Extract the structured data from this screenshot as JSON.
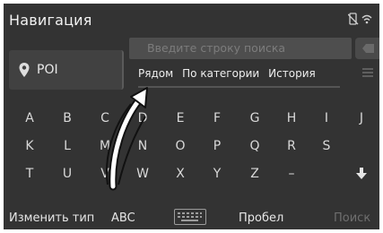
{
  "header": {
    "title": "Навигация",
    "status_icons": [
      "phone-off-icon",
      "wifi-icon"
    ]
  },
  "search": {
    "placeholder": "Введите строку поиска",
    "button_icon": "backspace-icon"
  },
  "poi": {
    "icon": "location-pin-icon",
    "label": "POI"
  },
  "tabs": [
    "Рядом",
    "По категории",
    "История"
  ],
  "keyboard": {
    "rows": [
      [
        "A",
        "B",
        "C",
        "D",
        "E",
        "F",
        "G",
        "H",
        "I",
        "J"
      ],
      [
        "K",
        "L",
        "M",
        "N",
        "O",
        "P",
        "Q",
        "R",
        "S"
      ],
      [
        "T",
        "U",
        "V",
        "W",
        "X",
        "Y",
        "Z",
        "–"
      ]
    ],
    "down_arrow_icon": "arrow-down-icon"
  },
  "bottom_bar": {
    "change_type": "Изменить тип",
    "abc": "ABC",
    "keyboard_icon": "keyboard-icon",
    "space": "Пробел",
    "search": "Поиск"
  },
  "annotation": {
    "arrow_icon": "pointer-arrow-annotation"
  },
  "colors": {
    "background": "#333333",
    "text": "#f0f0f0",
    "muted": "#7c7c7c"
  }
}
